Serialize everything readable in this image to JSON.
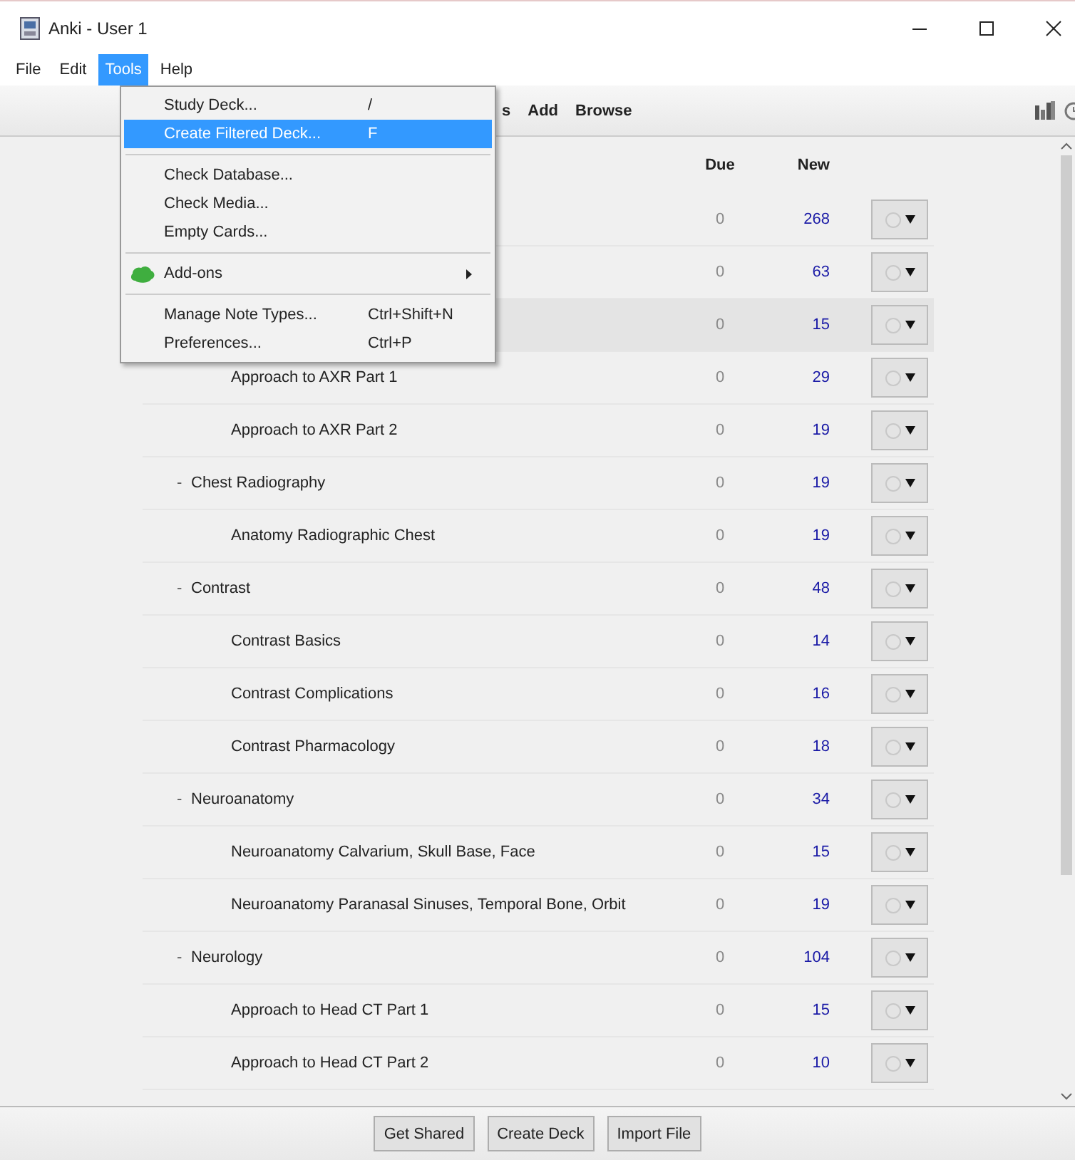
{
  "window": {
    "title": "Anki - User 1"
  },
  "menu_bar": [
    {
      "label": "File",
      "selected": false
    },
    {
      "label": "Edit",
      "selected": false
    },
    {
      "label": "Tools",
      "selected": true
    },
    {
      "label": "Help",
      "selected": false
    }
  ],
  "toolbar": [
    "s",
    "Add",
    "Browse"
  ],
  "columns": {
    "due": "Due",
    "new": "New"
  },
  "decks": [
    {
      "due": "0",
      "new": "268",
      "selected": false
    },
    {
      "due": "0",
      "new": "63",
      "selected": false
    },
    {
      "due": "0",
      "new": "15",
      "selected": true,
      "children": [
        {
          "name": "Approach to AXR Part 1",
          "due": "0",
          "new": "29",
          "selected": false
        },
        {
          "name": "Approach to AXR Part 2",
          "due": "0",
          "new": "19",
          "selected": false
        }
      ]
    },
    {
      "name": "Chest Radiography",
      "expander": "-",
      "due": "0",
      "new": "19",
      "selected": false,
      "children": [
        {
          "name": "Anatomy Radiographic Chest",
          "due": "0",
          "new": "19",
          "selected": false
        }
      ]
    },
    {
      "name": "Contrast",
      "expander": "-",
      "due": "0",
      "new": "48",
      "selected": false,
      "children": [
        {
          "name": "Contrast Basics",
          "due": "0",
          "new": "14",
          "selected": false
        },
        {
          "name": "Contrast Complications",
          "due": "0",
          "new": "16",
          "selected": false
        },
        {
          "name": "Contrast Pharmacology",
          "due": "0",
          "new": "18",
          "selected": false
        }
      ]
    },
    {
      "name": "Neuroanatomy",
      "expander": "-",
      "due": "0",
      "new": "34",
      "selected": false,
      "children": [
        {
          "name": "Neuroanatomy Calvarium, Skull Base, Face",
          "due": "0",
          "new": "15",
          "selected": false
        },
        {
          "name": "Neuroanatomy Paranasal Sinuses, Temporal Bone, Orbit",
          "due": "0",
          "new": "19",
          "selected": false
        }
      ]
    },
    {
      "name": "Neurology",
      "expander": "-",
      "due": "0",
      "new": "104",
      "selected": false,
      "children": [
        {
          "name": "Approach to Head CT Part 1",
          "due": "0",
          "new": "15",
          "selected": false
        },
        {
          "name": "Approach to Head CT Part 2",
          "due": "0",
          "new": "10",
          "selected": false
        }
      ]
    }
  ],
  "tools_menu": [
    {
      "kind": "item",
      "label": "Study Deck...",
      "shortcut": "/",
      "selected": false
    },
    {
      "kind": "item",
      "label": "Create Filtered Deck...",
      "shortcut": "F",
      "selected": true
    },
    {
      "kind": "separator"
    },
    {
      "kind": "item",
      "label": "Check Database...",
      "selected": false
    },
    {
      "kind": "item",
      "label": "Check Media...",
      "selected": false
    },
    {
      "kind": "item",
      "label": "Empty Cards...",
      "selected": false
    },
    {
      "kind": "separator"
    },
    {
      "kind": "submenu",
      "label": "Add-ons",
      "selected": false
    },
    {
      "kind": "separator"
    },
    {
      "kind": "item",
      "label": "Manage Note Types...",
      "shortcut": "Ctrl+Shift+N",
      "selected": false
    },
    {
      "kind": "item",
      "label": "Preferences...",
      "shortcut": "Ctrl+P",
      "selected": false
    }
  ],
  "bottom_buttons": [
    "Get Shared",
    "Create Deck",
    "Import File"
  ]
}
